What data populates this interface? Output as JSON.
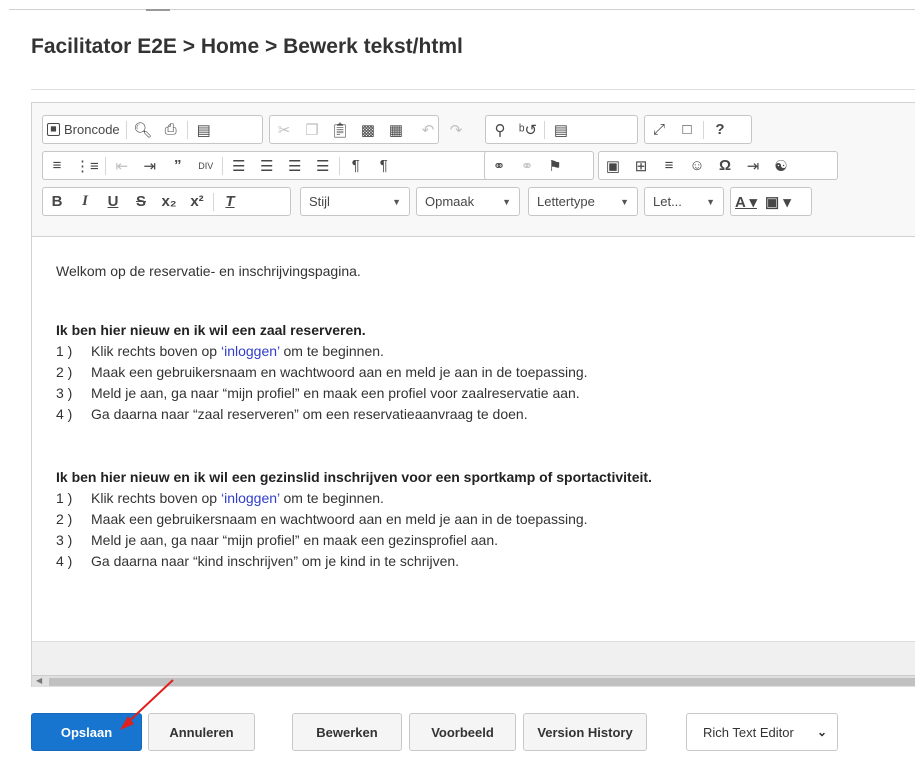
{
  "page": {
    "breadcrumb": "Facilitator E2E > Home > Bewerk tekst/html"
  },
  "toolbar": {
    "source_label": "Broncode",
    "style_combo": "Stijl",
    "format_combo": "Opmaak",
    "font_combo": "Lettertype",
    "size_combo": "Let..."
  },
  "content": {
    "intro": "Welkom op de reservatie- en inschrijvingspagina.",
    "sections": [
      {
        "heading": "Ik ben hier nieuw en ik wil een zaal reserveren.",
        "items": [
          {
            "num": "1 )",
            "pre": "Klik rechts boven op ",
            "link": "‘inloggen’",
            "post": " om te beginnen."
          },
          {
            "num": "2 )",
            "pre": "Maak een gebruikersnaam en wachtwoord aan en meld je aan in de toepassing.",
            "link": "",
            "post": ""
          },
          {
            "num": "3 )",
            "pre": "Meld je aan, ga naar “mijn profiel” en maak een profiel voor zaalreservatie aan.",
            "link": "",
            "post": ""
          },
          {
            "num": "4 )",
            "pre": "Ga daarna naar “zaal reserveren” om een reservatieaanvraag te doen.",
            "link": "",
            "post": ""
          }
        ]
      },
      {
        "heading": "Ik ben hier nieuw en ik wil een gezinslid inschrijven voor een sportkamp of sportactiviteit.",
        "items": [
          {
            "num": "1 )",
            "pre": "Klik rechts boven op ",
            "link": "‘inloggen’",
            "post": " om te beginnen."
          },
          {
            "num": "2 )",
            "pre": "Maak een gebruikersnaam en wachtwoord aan en meld je aan in de toepassing.",
            "link": "",
            "post": ""
          },
          {
            "num": "3 )",
            "pre": "Meld je aan, ga naar “mijn profiel” en maak een gezinsprofiel aan.",
            "link": "",
            "post": ""
          },
          {
            "num": "4 )",
            "pre": "Ga daarna naar “kind inschrijven” om je kind in te schrijven.",
            "link": "",
            "post": ""
          }
        ]
      }
    ]
  },
  "actions": {
    "save": "Opslaan",
    "cancel": "Annuleren",
    "edit": "Bewerken",
    "preview": "Voorbeeld",
    "history": "Version History",
    "editor_mode": "Rich Text Editor"
  },
  "colors": {
    "primary": "#1875cf",
    "link": "#2f3dc9",
    "annotation": "#e0201c"
  }
}
